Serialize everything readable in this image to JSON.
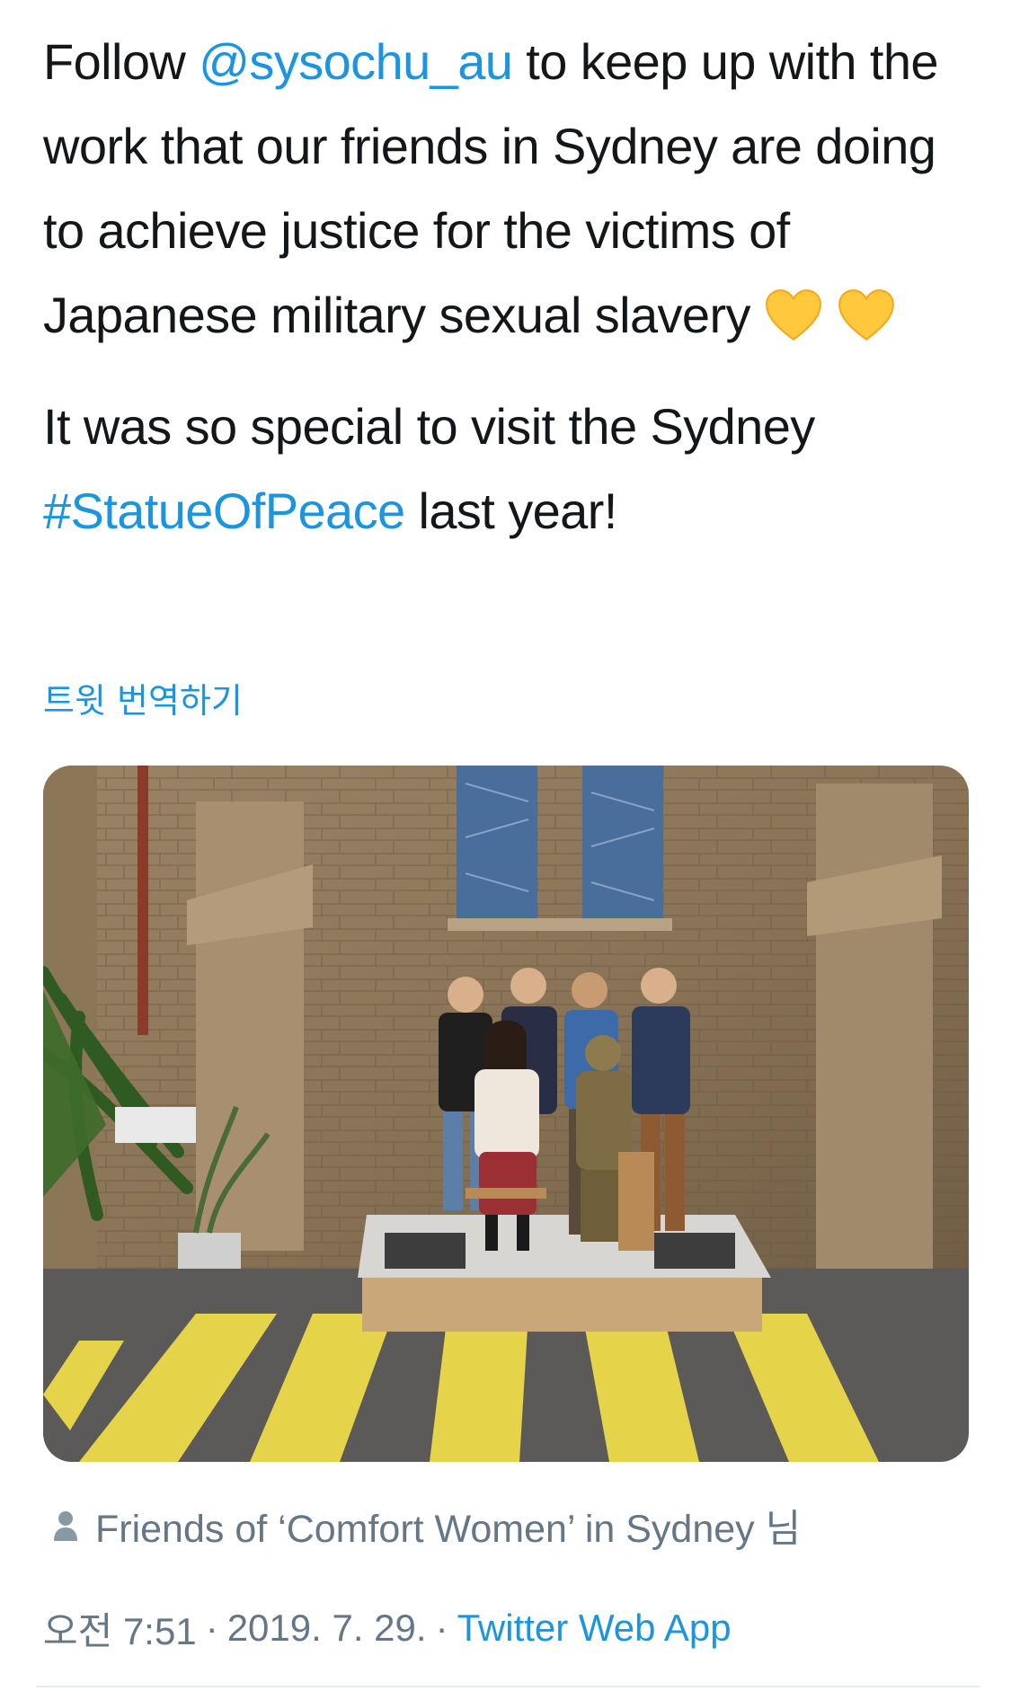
{
  "tweet": {
    "para1": {
      "before": "Follow ",
      "mention": "@sysochu_au",
      "after": " to keep up with the work that our friends in Sydney are doing to achieve justice for the victims of Japanese military sexual slavery "
    },
    "para2": {
      "before": "It was so special to visit the Sydney ",
      "hashtag": "#StatueOfPeace",
      "after": " last year!"
    },
    "emoji": "yellow-heart"
  },
  "translate_label": "트윗 번역하기",
  "tagged": {
    "icon": "person-icon",
    "text": "Friends of ‘Comfort Women’ in Sydney 님"
  },
  "meta": {
    "time": "오전 7:51",
    "separator": "·",
    "date": "2019. 7. 29.",
    "source": "Twitter Web App"
  },
  "colors": {
    "link": "#1b95e0",
    "secondary": "#657786",
    "text": "#14171a",
    "heart": "#ffc83d"
  }
}
